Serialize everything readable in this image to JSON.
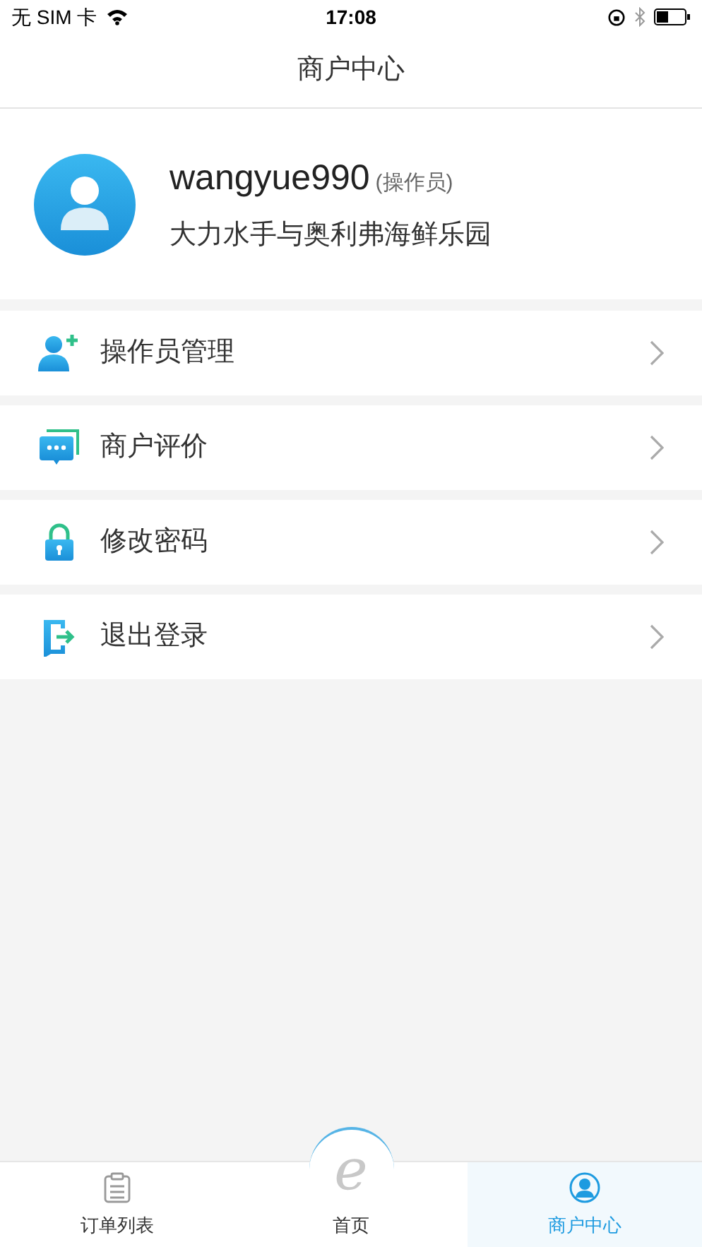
{
  "status_bar": {
    "carrier": "无 SIM 卡",
    "time": "17:08"
  },
  "nav_bar": {
    "title": "商户中心"
  },
  "profile": {
    "username": "wangyue990",
    "role": "(操作员)",
    "store": "大力水手与奥利弗海鲜乐园"
  },
  "menu": [
    {
      "kind": "operators",
      "label": "操作员管理"
    },
    {
      "kind": "reviews",
      "label": "商户评价"
    },
    {
      "kind": "password",
      "label": "修改密码"
    },
    {
      "kind": "logout",
      "label": "退出登录"
    }
  ],
  "tab_bar": [
    {
      "kind": "orders",
      "label": "订单列表",
      "selected": false
    },
    {
      "kind": "home",
      "label": "首页",
      "logo": "e",
      "selected": false
    },
    {
      "kind": "merchant",
      "label": "商户中心",
      "selected": true
    }
  ]
}
